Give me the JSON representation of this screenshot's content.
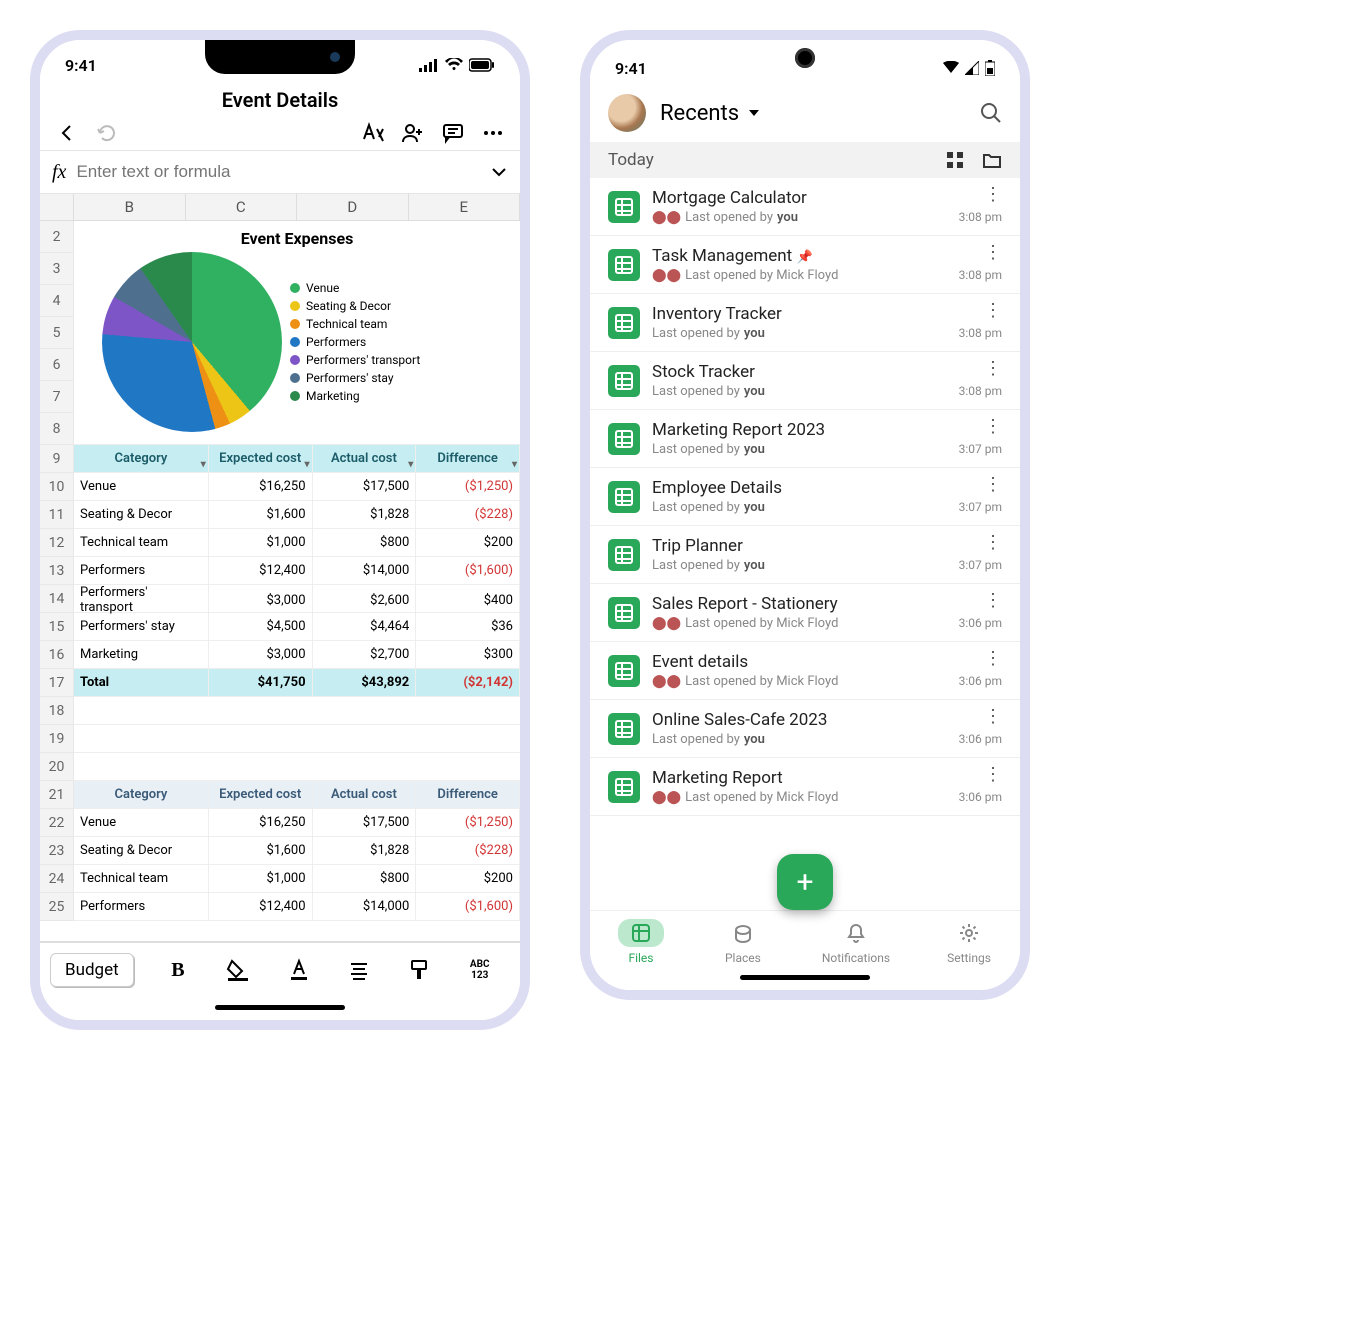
{
  "left": {
    "statusbar": {
      "time": "9:41"
    },
    "title": "Event Details",
    "formula": {
      "placeholder": "Enter text or formula"
    },
    "columns": [
      "B",
      "C",
      "D",
      "E"
    ],
    "row_labels": [
      "2",
      "3",
      "4",
      "5",
      "6",
      "7",
      "8",
      "9",
      "10",
      "11",
      "12",
      "13",
      "14",
      "15",
      "16",
      "17",
      "18",
      "19",
      "20",
      "21",
      "22",
      "23",
      "24",
      "25"
    ],
    "chart_data": {
      "type": "pie",
      "title": "Event Expenses",
      "series": [
        {
          "name": "Venue",
          "value": 16250,
          "color": "#30b061"
        },
        {
          "name": "Seating & Decor",
          "value": 1600,
          "color": "#ecc517"
        },
        {
          "name": "Technical team",
          "value": 1000,
          "color": "#ee9013"
        },
        {
          "name": "Performers",
          "value": 12400,
          "color": "#2077c4"
        },
        {
          "name": "Performers' transport",
          "value": 3000,
          "color": "#7d55c7"
        },
        {
          "name": "Performers' stay",
          "value": 4500,
          "color": "#4f6f8f"
        },
        {
          "name": "Marketing",
          "value": 3000,
          "color": "#2a8a4b"
        }
      ]
    },
    "headers": [
      "Category",
      "Expected cost",
      "Actual cost",
      "Difference"
    ],
    "rows": [
      {
        "cat": "Venue",
        "exp": "$16,250",
        "act": "$17,500",
        "diff": "($1,250)",
        "neg": true
      },
      {
        "cat": "Seating & Decor",
        "exp": "$1,600",
        "act": "$1,828",
        "diff": "($228)",
        "neg": true
      },
      {
        "cat": "Technical team",
        "exp": "$1,000",
        "act": "$800",
        "diff": "$200",
        "neg": false
      },
      {
        "cat": "Performers",
        "exp": "$12,400",
        "act": "$14,000",
        "diff": "($1,600)",
        "neg": true
      },
      {
        "cat": "Performers' transport",
        "exp": "$3,000",
        "act": "$2,600",
        "diff": "$400",
        "neg": false
      },
      {
        "cat": "Performers' stay",
        "exp": "$4,500",
        "act": "$4,464",
        "diff": "$36",
        "neg": false
      },
      {
        "cat": "Marketing",
        "exp": "$3,000",
        "act": "$2,700",
        "diff": "$300",
        "neg": false
      }
    ],
    "total": {
      "cat": "Total",
      "exp": "$41,750",
      "act": "$43,892",
      "diff": "($2,142)",
      "neg": true
    },
    "rows2": [
      {
        "cat": "Venue",
        "exp": "$16,250",
        "act": "$17,500",
        "diff": "($1,250)",
        "neg": true
      },
      {
        "cat": "Seating & Decor",
        "exp": "$1,600",
        "act": "$1,828",
        "diff": "($228)",
        "neg": true
      },
      {
        "cat": "Technical team",
        "exp": "$1,000",
        "act": "$800",
        "diff": "$200",
        "neg": false
      },
      {
        "cat": "Performers",
        "exp": "$12,400",
        "act": "$14,000",
        "diff": "($1,600)",
        "neg": true
      }
    ],
    "sheet_tab": "Budget",
    "abc_label": "ABC\n123"
  },
  "right": {
    "statusbar": {
      "time": "9:41"
    },
    "header_title": "Recents",
    "section": "Today",
    "opened_by_prefix": "Last opened by ",
    "you_label": "you",
    "files": [
      {
        "name": "Mortgage Calculator",
        "by": "you",
        "shared": true,
        "time": "3:08 pm",
        "pinned": false
      },
      {
        "name": "Task Management",
        "by": "Mick Floyd",
        "shared": true,
        "time": "3:08 pm",
        "pinned": true
      },
      {
        "name": "Inventory Tracker",
        "by": "you",
        "shared": false,
        "time": "3:08 pm",
        "pinned": false
      },
      {
        "name": "Stock Tracker",
        "by": "you",
        "shared": false,
        "time": "3:08 pm",
        "pinned": false
      },
      {
        "name": "Marketing Report 2023",
        "by": "you",
        "shared": false,
        "time": "3:07 pm",
        "pinned": false
      },
      {
        "name": "Employee Details",
        "by": "you",
        "shared": false,
        "time": "3:07 pm",
        "pinned": false
      },
      {
        "name": "Trip Planner",
        "by": "you",
        "shared": false,
        "time": "3:07 pm",
        "pinned": false
      },
      {
        "name": "Sales Report - Stationery",
        "by": "Mick Floyd",
        "shared": true,
        "time": "3:06 pm",
        "pinned": false
      },
      {
        "name": "Event details",
        "by": "Mick Floyd",
        "shared": true,
        "time": "3:06 pm",
        "pinned": false
      },
      {
        "name": "Online Sales-Cafe 2023",
        "by": "you",
        "shared": false,
        "time": "3:06 pm",
        "pinned": false
      },
      {
        "name": "Marketing Report",
        "by": "Mick Floyd",
        "shared": true,
        "time": "3:06 pm",
        "pinned": false
      }
    ],
    "nav": [
      {
        "label": "Files",
        "active": true
      },
      {
        "label": "Places",
        "active": false
      },
      {
        "label": "Notifications",
        "active": false
      },
      {
        "label": "Settings",
        "active": false
      }
    ]
  }
}
